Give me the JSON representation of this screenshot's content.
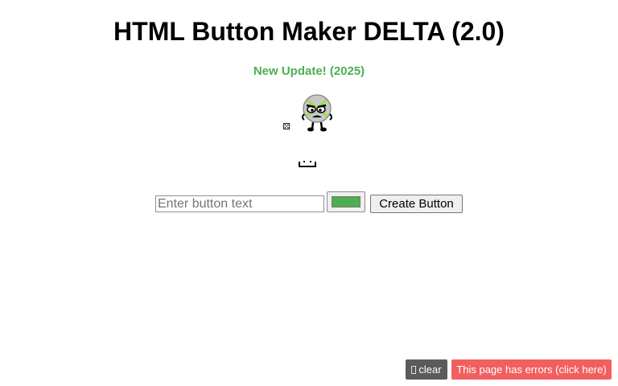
{
  "header": {
    "title": "HTML Button Maker DELTA (2.0)",
    "update_link": "New Update! (2025)"
  },
  "icons": {
    "dice": "dice-icon",
    "dice_glyph": "⚄",
    "mascot": "mascot-character-icon",
    "bracket": "bracket-icon"
  },
  "form": {
    "text_placeholder": "Enter button text",
    "text_value": "",
    "color_value": "#4caf50",
    "create_label": "Create Button"
  },
  "footer": {
    "clear_label": "clear",
    "errors_label": "This page has errors (click here)"
  },
  "colors": {
    "accent": "#4caf50",
    "error": "#f25f5f",
    "clear_bg": "#5b5b5b"
  }
}
